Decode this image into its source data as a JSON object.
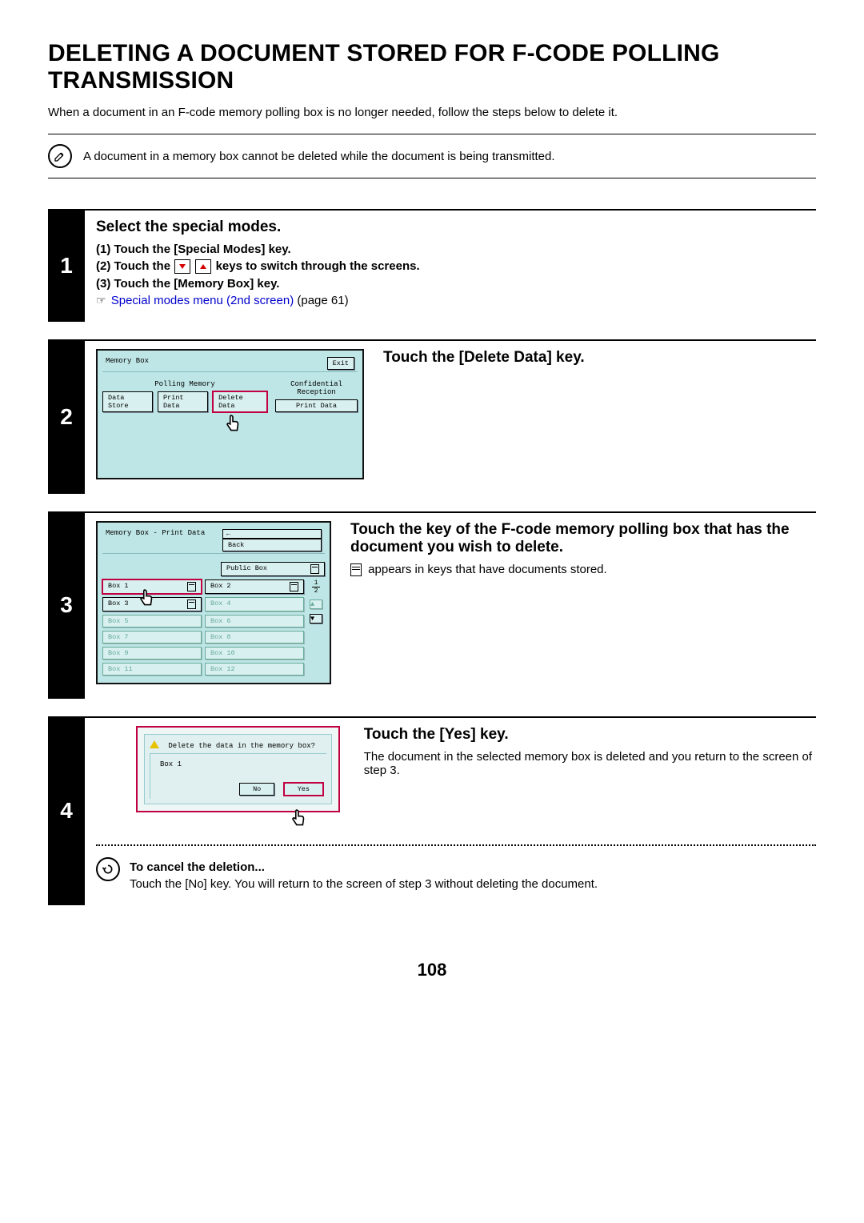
{
  "title": "DELETING A DOCUMENT STORED FOR F-CODE POLLING TRANSMISSION",
  "intro": "When a document in an F-code memory polling box is no longer needed, follow the steps below to delete it.",
  "note": "A document in a memory box cannot be deleted while the document is being transmitted.",
  "step1": {
    "num": "1",
    "title": "Select the special modes.",
    "l1": "(1)  Touch the [Special Modes] key.",
    "l2a": "(2)  Touch the ",
    "l2b": " keys to switch through the screens.",
    "l3": "(3)  Touch the [Memory Box] key.",
    "link": "Special modes menu (2nd screen)",
    "link_suffix": " (page 61)"
  },
  "step2": {
    "num": "2",
    "title": "Touch the [Delete Data] key.",
    "lcd_title": "Memory Box",
    "exit": "Exit",
    "polling_label": "Polling Memory",
    "conf_label": "Confidential Reception",
    "b_store": "Data Store",
    "b_print": "Print Data",
    "b_delete": "Delete Data",
    "b_print2": "Print Data"
  },
  "step3": {
    "num": "3",
    "title": "Touch the key of the F-code memory polling box that has the document you wish to delete.",
    "desc": " appears in keys that have documents stored.",
    "lcd_title": "Memory Box - Print Data",
    "back": "Back",
    "public": "Public Box",
    "page": "1",
    "total": "2",
    "boxes": [
      "Box 1",
      "Box 2",
      "Box 3",
      "Box 4",
      "Box 5",
      "Box 6",
      "Box 7",
      "Box 8",
      "Box 9",
      "Box 10",
      "Box 11",
      "Box 12"
    ]
  },
  "step4": {
    "num": "4",
    "title": "Touch the [Yes] key.",
    "desc": "The document in the selected memory box is deleted and you return to the screen of step 3.",
    "dlg_msg": "Delete the data in the memory box?",
    "dlg_box": "Box 1",
    "no": "No",
    "yes": "Yes",
    "cancel_title": "To cancel the deletion...",
    "cancel_body": "Touch the [No] key. You will return to the screen of step 3 without deleting the document."
  },
  "page_num": "108"
}
